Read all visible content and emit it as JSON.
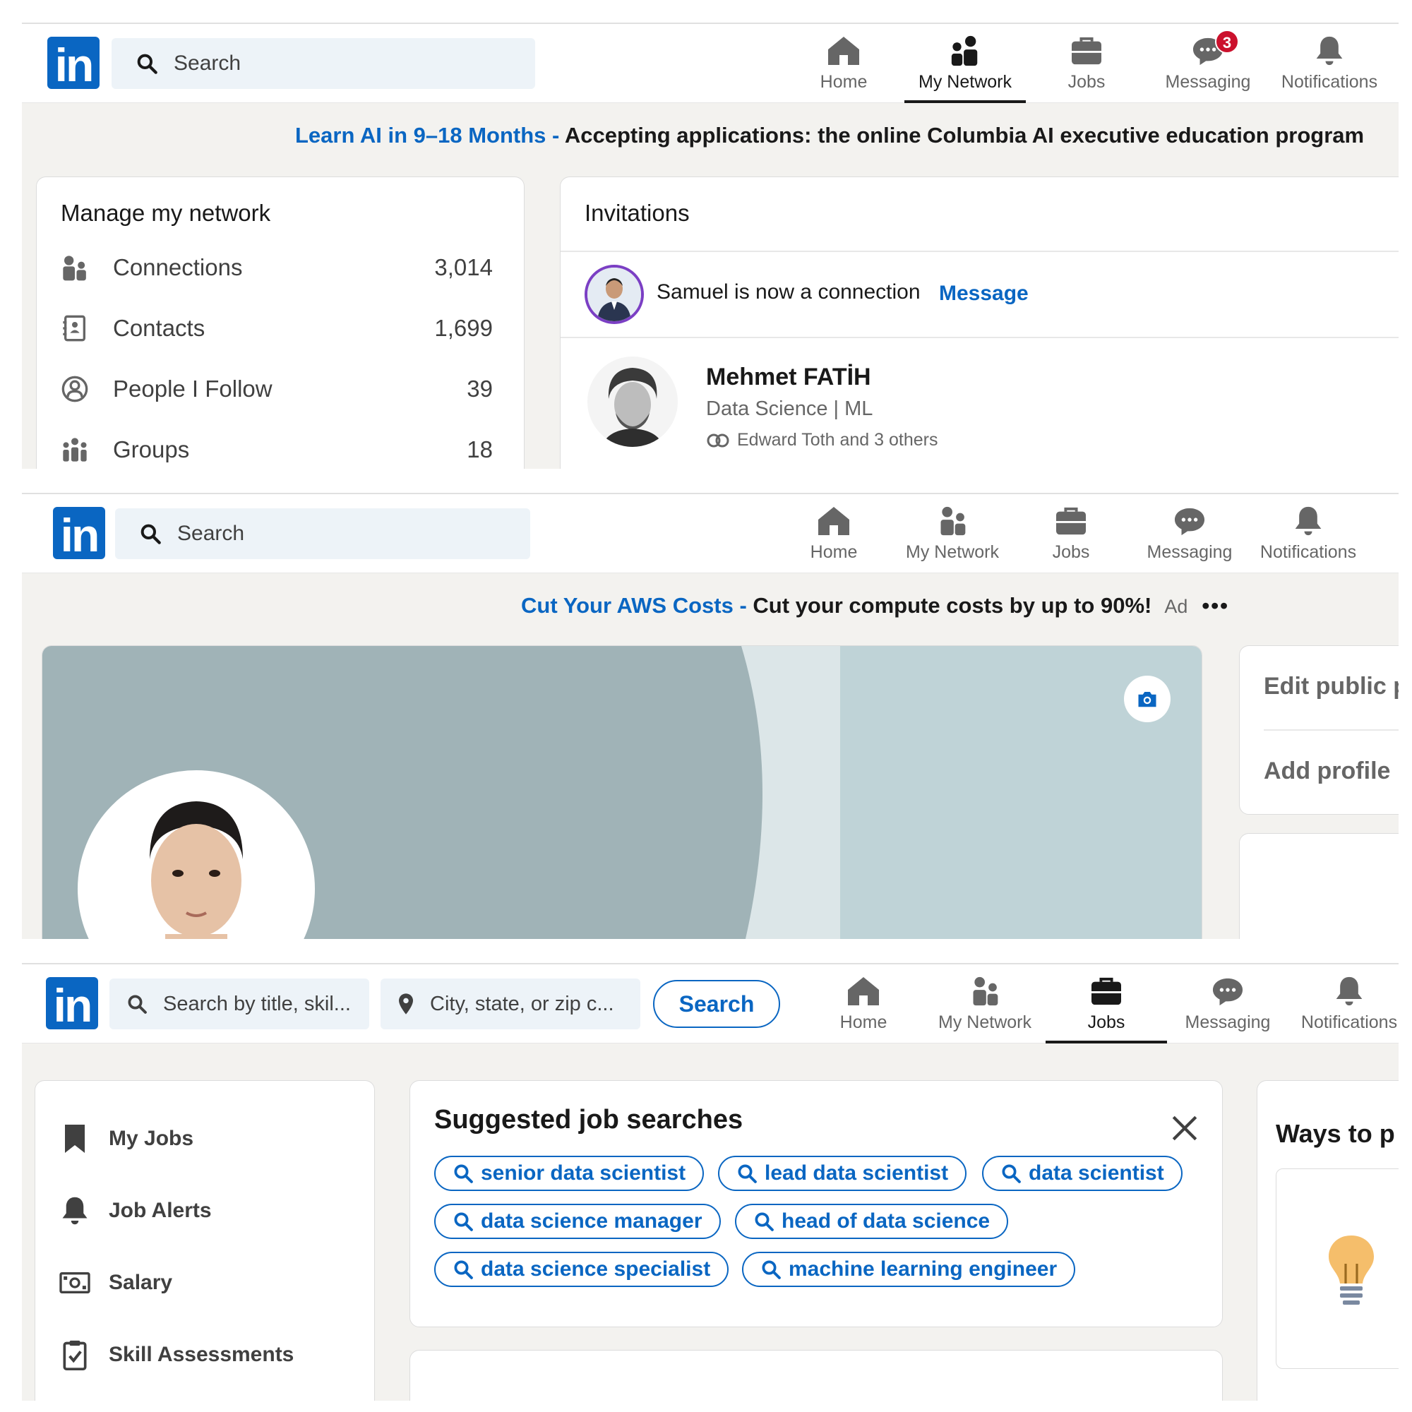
{
  "brand": {
    "logo_text": "in",
    "color": "#0a66c2"
  },
  "nav_labels": {
    "home": "Home",
    "network": "My Network",
    "jobs": "Jobs",
    "messaging": "Messaging",
    "notifications": "Notifications"
  },
  "screen1": {
    "search_placeholder": "Search",
    "messaging_badge": "3",
    "active_tab": "My Network",
    "banner": {
      "link": "Learn AI in 9–18 Months -",
      "text": " Accepting applications: the online Columbia AI executive education program"
    },
    "manage": {
      "title": "Manage my network",
      "items": [
        {
          "icon": "connections-icon",
          "label": "Connections",
          "count": "3,014"
        },
        {
          "icon": "contacts-icon",
          "label": "Contacts",
          "count": "1,699"
        },
        {
          "icon": "people-follow-icon",
          "label": "People I Follow",
          "count": "39"
        },
        {
          "icon": "groups-icon",
          "label": "Groups",
          "count": "18"
        }
      ]
    },
    "invitations": {
      "title": "Invitations",
      "notice": "Samuel is now a connection",
      "notice_action": "Message",
      "person_name": "Mehmet FATİH",
      "person_headline": "Data Science | ML",
      "person_mutual": "Edward Toth and 3 others"
    }
  },
  "screen2": {
    "search_placeholder": "Search",
    "banner": {
      "link": "Cut Your AWS Costs -",
      "text": " Cut your compute costs by up to 90%!",
      "ad_label": "Ad",
      "more": "•••"
    },
    "side": {
      "edit_public": "Edit public p",
      "add_profile": "Add profile i"
    }
  },
  "screen3": {
    "search_title_placeholder": "Search by title, skil...",
    "search_location_placeholder": "City, state, or zip c...",
    "search_button": "Search",
    "active_tab": "Jobs",
    "sidebar": [
      {
        "icon": "bookmark-icon",
        "label": "My Jobs"
      },
      {
        "icon": "bell-icon",
        "label": "Job Alerts"
      },
      {
        "icon": "salary-icon",
        "label": "Salary"
      },
      {
        "icon": "clipboard-icon",
        "label": "Skill Assessments"
      }
    ],
    "suggested": {
      "title": "Suggested job searches",
      "pills": [
        "senior data scientist",
        "lead data scientist",
        "data scientist",
        "data science manager",
        "head of data science",
        "data science specialist",
        "machine learning engineer"
      ]
    },
    "ways_title": "Ways to p"
  }
}
